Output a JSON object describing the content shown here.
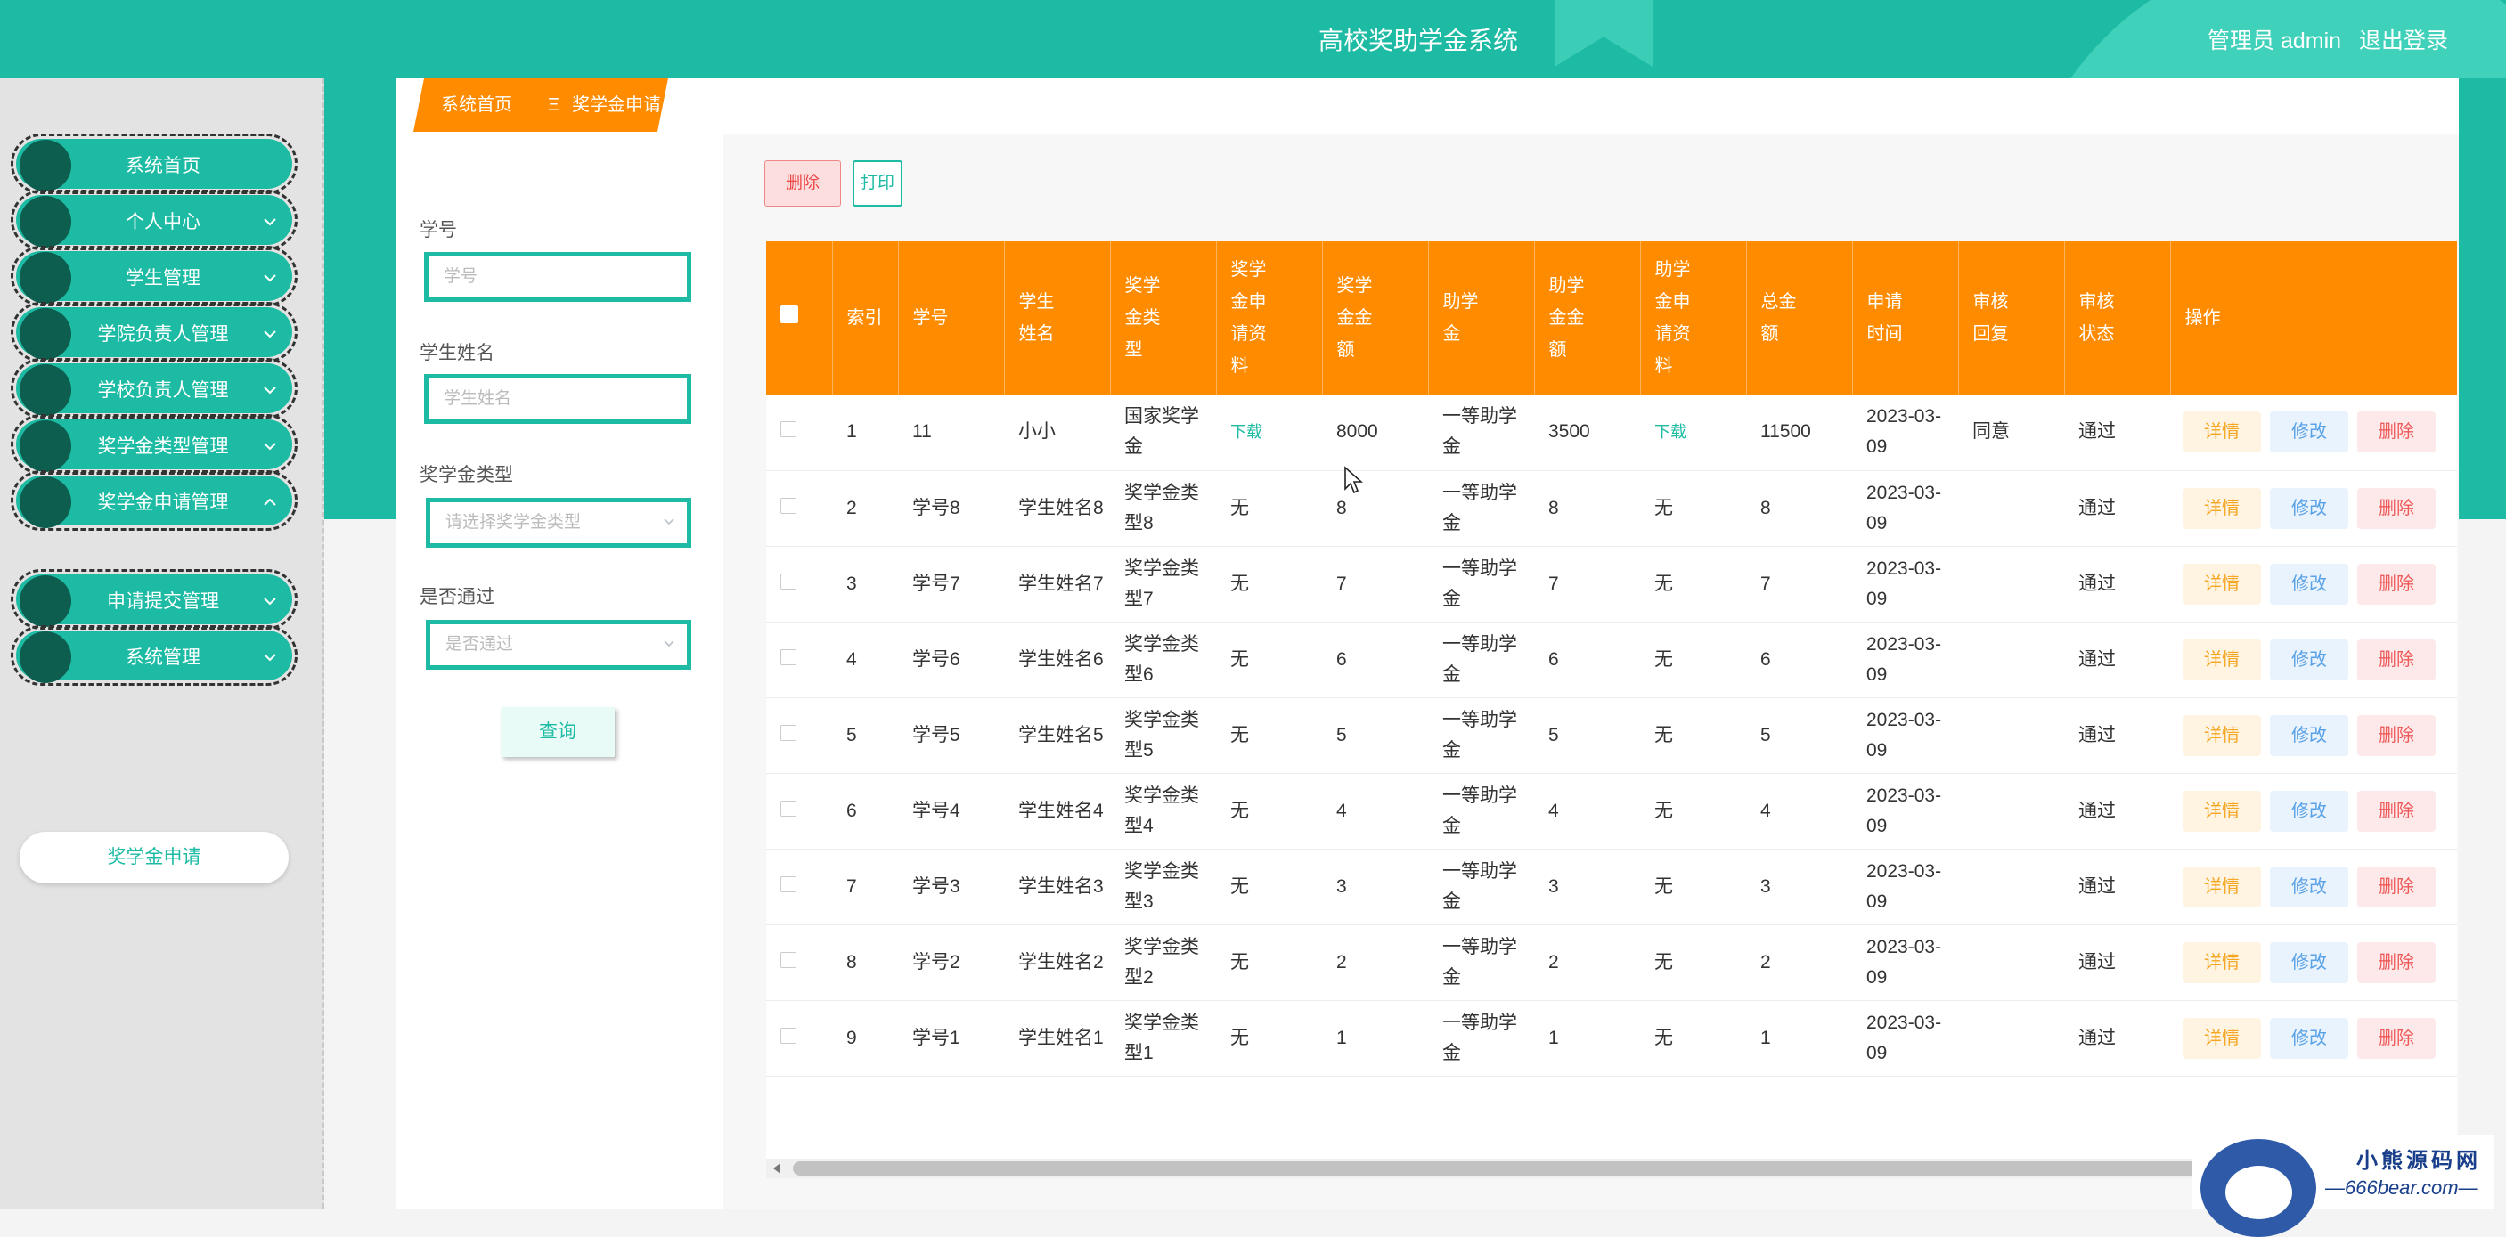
{
  "header": {
    "title": "高校奖助学金系统",
    "user_label": "管理员 admin",
    "logout": "退出登录"
  },
  "sidebar": {
    "items": [
      {
        "label": "系统首页",
        "chevron": "none"
      },
      {
        "label": "个人中心",
        "chevron": "down"
      },
      {
        "label": "学生管理",
        "chevron": "down"
      },
      {
        "label": "学院负责人管理",
        "chevron": "down"
      },
      {
        "label": "学校负责人管理",
        "chevron": "down"
      },
      {
        "label": "奖学金类型管理",
        "chevron": "down"
      },
      {
        "label": "奖学金申请管理",
        "chevron": "up"
      },
      {
        "label": "申请提交管理",
        "chevron": "down"
      },
      {
        "label": "系统管理",
        "chevron": "down"
      }
    ],
    "submenu": {
      "label": "奖学金申请"
    }
  },
  "breadcrumb": {
    "home": "系统首页",
    "separator": "Ξ",
    "current": "奖学金申请"
  },
  "search": {
    "student_no_label": "学号",
    "student_no_placeholder": "学号",
    "student_name_label": "学生姓名",
    "student_name_placeholder": "学生姓名",
    "type_label": "奖学金类型",
    "type_placeholder": "请选择奖学金类型",
    "pass_label": "是否通过",
    "pass_placeholder": "是否通过",
    "query_button": "查询"
  },
  "toolbar": {
    "delete_label": "删除",
    "print_label": "打印"
  },
  "table": {
    "columns": [
      {
        "key": "check",
        "label": ""
      },
      {
        "key": "index",
        "label": "索引"
      },
      {
        "key": "no",
        "label": "学号"
      },
      {
        "key": "name",
        "label": "学生姓名"
      },
      {
        "key": "type",
        "label": "奖学金类型"
      },
      {
        "key": "sch_file",
        "label": "奖学金申请资料"
      },
      {
        "key": "sch_amount",
        "label": "奖学金金额"
      },
      {
        "key": "grant",
        "label": "助学金"
      },
      {
        "key": "grant_amount",
        "label": "助学金金额"
      },
      {
        "key": "grant_file",
        "label": "助学金申请资料"
      },
      {
        "key": "total",
        "label": "总金额"
      },
      {
        "key": "time",
        "label": "申请时间"
      },
      {
        "key": "reply",
        "label": "审核回复"
      },
      {
        "key": "status",
        "label": "审核状态"
      },
      {
        "key": "ops",
        "label": "操作"
      }
    ],
    "op_labels": {
      "detail": "详情",
      "edit": "修改",
      "remove": "删除"
    },
    "rows": [
      {
        "index": "1",
        "no": "11",
        "name": "小小",
        "type": "国家奖学金",
        "sch_file": "下载",
        "sch_amount": "8000",
        "grant": "一等助学金",
        "grant_amount": "3500",
        "grant_file": "下载",
        "total": "11500",
        "time": "2023-03-09",
        "reply": "同意",
        "status": "通过"
      },
      {
        "index": "2",
        "no": "学号8",
        "name": "学生姓名8",
        "type": "奖学金类型8",
        "sch_file": "无",
        "sch_amount": "8",
        "grant": "一等助学金",
        "grant_amount": "8",
        "grant_file": "无",
        "total": "8",
        "time": "2023-03-09",
        "reply": "",
        "status": "通过"
      },
      {
        "index": "3",
        "no": "学号7",
        "name": "学生姓名7",
        "type": "奖学金类型7",
        "sch_file": "无",
        "sch_amount": "7",
        "grant": "一等助学金",
        "grant_amount": "7",
        "grant_file": "无",
        "total": "7",
        "time": "2023-03-09",
        "reply": "",
        "status": "通过"
      },
      {
        "index": "4",
        "no": "学号6",
        "name": "学生姓名6",
        "type": "奖学金类型6",
        "sch_file": "无",
        "sch_amount": "6",
        "grant": "一等助学金",
        "grant_amount": "6",
        "grant_file": "无",
        "total": "6",
        "time": "2023-03-09",
        "reply": "",
        "status": "通过"
      },
      {
        "index": "5",
        "no": "学号5",
        "name": "学生姓名5",
        "type": "奖学金类型5",
        "sch_file": "无",
        "sch_amount": "5",
        "grant": "一等助学金",
        "grant_amount": "5",
        "grant_file": "无",
        "total": "5",
        "time": "2023-03-09",
        "reply": "",
        "status": "通过"
      },
      {
        "index": "6",
        "no": "学号4",
        "name": "学生姓名4",
        "type": "奖学金类型4",
        "sch_file": "无",
        "sch_amount": "4",
        "grant": "一等助学金",
        "grant_amount": "4",
        "grant_file": "无",
        "total": "4",
        "time": "2023-03-09",
        "reply": "",
        "status": "通过"
      },
      {
        "index": "7",
        "no": "学号3",
        "name": "学生姓名3",
        "type": "奖学金类型3",
        "sch_file": "无",
        "sch_amount": "3",
        "grant": "一等助学金",
        "grant_amount": "3",
        "grant_file": "无",
        "total": "3",
        "time": "2023-03-09",
        "reply": "",
        "status": "通过"
      },
      {
        "index": "8",
        "no": "学号2",
        "name": "学生姓名2",
        "type": "奖学金类型2",
        "sch_file": "无",
        "sch_amount": "2",
        "grant": "一等助学金",
        "grant_amount": "2",
        "grant_file": "无",
        "total": "2",
        "time": "2023-03-09",
        "reply": "",
        "status": "通过"
      },
      {
        "index": "9",
        "no": "学号1",
        "name": "学生姓名1",
        "type": "奖学金类型1",
        "sch_file": "无",
        "sch_amount": "1",
        "grant": "一等助学金",
        "grant_amount": "1",
        "grant_file": "无",
        "total": "1",
        "time": "2023-03-09",
        "reply": "",
        "status": "通过"
      }
    ]
  },
  "watermark": {
    "line1": "小熊源码网",
    "line2": "—666bear.com—"
  },
  "colors": {
    "primary": "#1dbba4",
    "accent": "#ff8c00",
    "dark_dot": "#0d5e4e"
  }
}
